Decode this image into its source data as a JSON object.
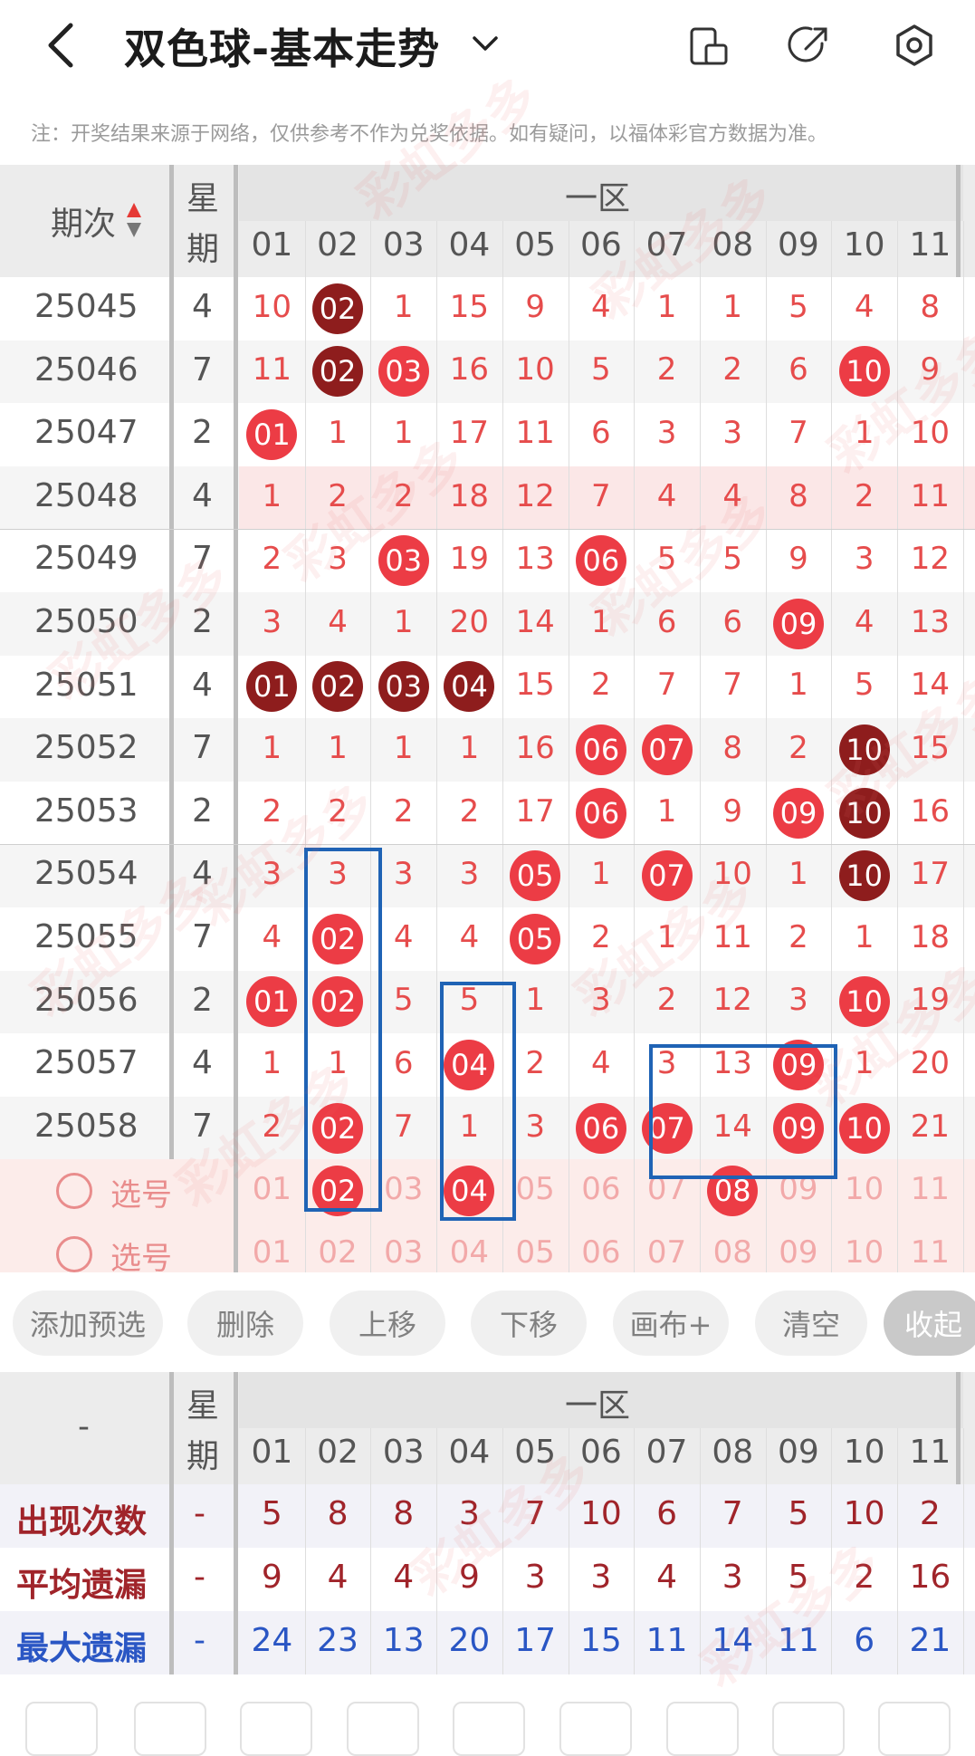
{
  "header": {
    "title": "双色球-基本走势",
    "icons": [
      "back-icon",
      "chevron-down-icon",
      "phone-layout-icon",
      "share-icon",
      "settings-icon"
    ]
  },
  "notice": "注：开奖结果来源于网络，仅供参考不作为兑奖依据。如有疑问，以福体彩官方数据为准。",
  "table": {
    "period_header": "期次",
    "week_header": [
      "星",
      "期"
    ],
    "zone_header": "一区",
    "columns": [
      "01",
      "02",
      "03",
      "04",
      "05",
      "06",
      "07",
      "08",
      "09",
      "10",
      "11"
    ],
    "rows": [
      {
        "period": "25045",
        "week": "4",
        "cells": [
          "10",
          "02",
          "1",
          "15",
          "9",
          "4",
          "1",
          "1",
          "5",
          "4",
          "8"
        ],
        "hits": [
          1
        ],
        "dark": [
          1
        ]
      },
      {
        "period": "25046",
        "week": "7",
        "cells": [
          "11",
          "02",
          "03",
          "16",
          "10",
          "5",
          "2",
          "2",
          "6",
          "10",
          "9"
        ],
        "hits": [
          1,
          2,
          9
        ],
        "dark": [
          1
        ]
      },
      {
        "period": "25047",
        "week": "2",
        "cells": [
          "01",
          "1",
          "1",
          "17",
          "11",
          "6",
          "3",
          "3",
          "7",
          "1",
          "10"
        ],
        "hits": [
          0
        ],
        "dark": []
      },
      {
        "period": "25048",
        "week": "4",
        "cells": [
          "1",
          "2",
          "2",
          "18",
          "12",
          "7",
          "4",
          "4",
          "8",
          "2",
          "11"
        ],
        "hits": [],
        "dark": []
      },
      {
        "period": "25049",
        "week": "7",
        "cells": [
          "2",
          "3",
          "03",
          "19",
          "13",
          "06",
          "5",
          "5",
          "9",
          "3",
          "12"
        ],
        "hits": [
          2,
          5
        ],
        "dark": []
      },
      {
        "period": "25050",
        "week": "2",
        "cells": [
          "3",
          "4",
          "1",
          "20",
          "14",
          "1",
          "6",
          "6",
          "09",
          "4",
          "13"
        ],
        "hits": [
          8
        ],
        "dark": []
      },
      {
        "period": "25051",
        "week": "4",
        "cells": [
          "01",
          "02",
          "03",
          "04",
          "15",
          "2",
          "7",
          "7",
          "1",
          "5",
          "14"
        ],
        "hits": [
          0,
          1,
          2,
          3
        ],
        "dark": [
          0,
          1,
          2,
          3
        ]
      },
      {
        "period": "25052",
        "week": "7",
        "cells": [
          "1",
          "1",
          "1",
          "1",
          "16",
          "06",
          "07",
          "8",
          "2",
          "10",
          "15"
        ],
        "hits": [
          5,
          6,
          9
        ],
        "dark": [
          9
        ]
      },
      {
        "period": "25053",
        "week": "2",
        "cells": [
          "2",
          "2",
          "2",
          "2",
          "17",
          "06",
          "1",
          "9",
          "09",
          "10",
          "16"
        ],
        "hits": [
          5,
          8,
          9
        ],
        "dark": [
          9
        ]
      },
      {
        "period": "25054",
        "week": "4",
        "cells": [
          "3",
          "3",
          "3",
          "3",
          "05",
          "1",
          "07",
          "10",
          "1",
          "10",
          "17"
        ],
        "hits": [
          4,
          6,
          9
        ],
        "dark": [
          9
        ]
      },
      {
        "period": "25055",
        "week": "7",
        "cells": [
          "4",
          "02",
          "4",
          "4",
          "05",
          "2",
          "1",
          "11",
          "2",
          "1",
          "18"
        ],
        "hits": [
          1,
          4
        ],
        "dark": []
      },
      {
        "period": "25056",
        "week": "2",
        "cells": [
          "01",
          "02",
          "5",
          "5",
          "1",
          "3",
          "2",
          "12",
          "3",
          "10",
          "19"
        ],
        "hits": [
          0,
          1,
          9
        ],
        "dark": []
      },
      {
        "period": "25057",
        "week": "4",
        "cells": [
          "1",
          "1",
          "6",
          "04",
          "2",
          "4",
          "3",
          "13",
          "09",
          "1",
          "20"
        ],
        "hits": [
          3,
          8
        ],
        "dark": []
      },
      {
        "period": "25058",
        "week": "7",
        "cells": [
          "2",
          "02",
          "7",
          "1",
          "3",
          "06",
          "07",
          "14",
          "09",
          "10",
          "21"
        ],
        "hits": [
          1,
          5,
          6,
          8,
          9
        ],
        "dark": []
      }
    ],
    "picks": [
      {
        "label": "选号",
        "cells": [
          "01",
          "02",
          "03",
          "04",
          "05",
          "06",
          "07",
          "08",
          "09",
          "10",
          "11"
        ],
        "hits": [
          1,
          3,
          7
        ]
      },
      {
        "label": "选号",
        "cells": [
          "01",
          "02",
          "03",
          "04",
          "05",
          "06",
          "07",
          "08",
          "09",
          "10",
          "11"
        ],
        "hits": []
      }
    ]
  },
  "buttons": [
    "添加预选",
    "删除",
    "上移",
    "下移",
    "画布+",
    "清空",
    "收起"
  ],
  "stats": {
    "corner": "-",
    "week_header": [
      "星",
      "期"
    ],
    "zone_header": "一区",
    "columns": [
      "01",
      "02",
      "03",
      "04",
      "05",
      "06",
      "07",
      "08",
      "09",
      "10",
      "11"
    ],
    "rows": [
      {
        "label": "出现次数",
        "week": "-",
        "values": [
          "5",
          "8",
          "8",
          "3",
          "7",
          "10",
          "6",
          "7",
          "5",
          "10",
          "2"
        ],
        "color": "#a0242a"
      },
      {
        "label": "平均遗漏",
        "week": "-",
        "values": [
          "9",
          "4",
          "4",
          "9",
          "3",
          "3",
          "4",
          "3",
          "5",
          "2",
          "16"
        ],
        "color": "#a0242a"
      },
      {
        "label": "最大遗漏",
        "week": "-",
        "values": [
          "24",
          "23",
          "13",
          "20",
          "17",
          "15",
          "11",
          "14",
          "11",
          "6",
          "21"
        ],
        "color": "#2a56c4"
      }
    ]
  },
  "watermark": "彩虹多多",
  "colors": {
    "ball": "#ec3c45",
    "ball_dark": "#8e1d1d",
    "box": "#1f63b5",
    "num": "#e64c4c"
  }
}
